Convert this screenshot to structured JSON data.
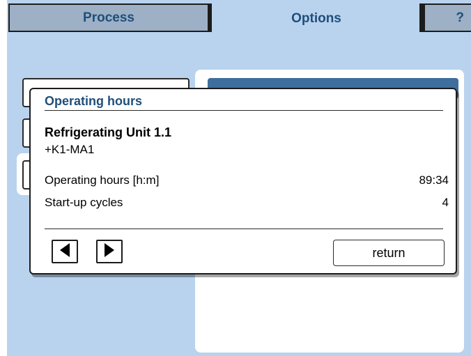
{
  "tabs": {
    "process": "Process",
    "options": "Options",
    "help": "?"
  },
  "dialog": {
    "title": "Operating hours",
    "unit_name": "Refrigerating Unit 1.1",
    "unit_code": "+K1-MA1",
    "rows": [
      {
        "label": "Operating hours [h:m]",
        "value": "89:34"
      },
      {
        "label": "Start-up cycles",
        "value": "4"
      }
    ],
    "prev_icon": "triangle-left-icon",
    "next_icon": "triangle-right-icon",
    "return_label": "return"
  },
  "colors": {
    "screen_bg": "#b9d3ee",
    "title_blue": "#1f4f7a",
    "inactive_tab": "#9db0c6",
    "panel_header": "#3f6d9e"
  }
}
